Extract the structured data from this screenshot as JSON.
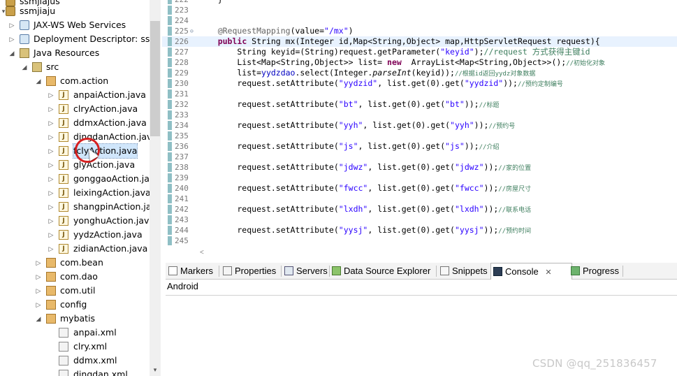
{
  "tree": {
    "rows": [
      {
        "label": "ssmjiajus",
        "icon": "project-icon"
      },
      {
        "label": "ssmjiaju",
        "icon": "project-icon"
      },
      {
        "label": "JAX-WS Web Services",
        "icon": "web-services-icon"
      },
      {
        "label": "Deployment Descriptor: ssmjiaju",
        "icon": "deployment-descriptor-icon"
      },
      {
        "label": "Java Resources",
        "icon": "java-resources-icon"
      },
      {
        "label": "src",
        "icon": "source-folder-icon"
      },
      {
        "label": "com.action",
        "icon": "package-icon"
      },
      {
        "label": "anpaiAction.java",
        "icon": "java-file-icon"
      },
      {
        "label": "clryAction.java",
        "icon": "java-file-icon"
      },
      {
        "label": "ddmxAction.java",
        "icon": "java-file-icon"
      },
      {
        "label": "dingdanAction.java",
        "icon": "java-file-icon"
      },
      {
        "label": "fclyAction.java",
        "icon": "java-file-icon"
      },
      {
        "label": "glyAction.java",
        "icon": "java-file-icon"
      },
      {
        "label": "gonggaoAction.java",
        "icon": "java-file-icon"
      },
      {
        "label": "leixingAction.java",
        "icon": "java-file-icon"
      },
      {
        "label": "shangpinAction.java",
        "icon": "java-file-icon"
      },
      {
        "label": "yonghuAction.java",
        "icon": "java-file-icon"
      },
      {
        "label": "yydzAction.java",
        "icon": "java-file-icon"
      },
      {
        "label": "zidianAction.java",
        "icon": "java-file-icon"
      },
      {
        "label": "com.bean",
        "icon": "package-icon"
      },
      {
        "label": "com.dao",
        "icon": "package-icon"
      },
      {
        "label": "com.util",
        "icon": "package-icon"
      },
      {
        "label": "config",
        "icon": "package-icon"
      },
      {
        "label": "mybatis",
        "icon": "package-icon"
      },
      {
        "label": "anpai.xml",
        "icon": "xml-file-icon"
      },
      {
        "label": "clry.xml",
        "icon": "xml-file-icon"
      },
      {
        "label": "ddmx.xml",
        "icon": "xml-file-icon"
      },
      {
        "label": "dingdan.xml",
        "icon": "xml-file-icon"
      }
    ]
  },
  "editor": {
    "lines": [
      {
        "n": "222",
        "code": "    }"
      },
      {
        "n": "223",
        "code": ""
      },
      {
        "n": "224",
        "code": ""
      },
      {
        "n": "225",
        "code": "    @RequestMapping(value=\"/mx\")"
      },
      {
        "n": "226",
        "code": "    public String mx(Integer id,Map<String,Object> map,HttpServletRequest request){"
      },
      {
        "n": "227",
        "code": "        String keyid=(String)request.getParameter(\"keyid\");//request 方式获得主键id"
      },
      {
        "n": "228",
        "code": "        List<Map<String,Object>> list= new  ArrayList<Map<String,Object>>();//初始化对象"
      },
      {
        "n": "229",
        "code": "        list=yydzdao.select(Integer.parseInt(keyid));//根据id返回yydz对象数据"
      },
      {
        "n": "230",
        "code": "        request.setAttribute(\"yydzid\", list.get(0).get(\"yydzid\"));//预约定制编号"
      },
      {
        "n": "231",
        "code": ""
      },
      {
        "n": "232",
        "code": "        request.setAttribute(\"bt\", list.get(0).get(\"bt\"));//标题"
      },
      {
        "n": "233",
        "code": ""
      },
      {
        "n": "234",
        "code": "        request.setAttribute(\"yyh\", list.get(0).get(\"yyh\"));//预约号"
      },
      {
        "n": "235",
        "code": ""
      },
      {
        "n": "236",
        "code": "        request.setAttribute(\"js\", list.get(0).get(\"js\"));//介绍"
      },
      {
        "n": "237",
        "code": ""
      },
      {
        "n": "238",
        "code": "        request.setAttribute(\"jdwz\", list.get(0).get(\"jdwz\"));//家的位置"
      },
      {
        "n": "239",
        "code": ""
      },
      {
        "n": "240",
        "code": "        request.setAttribute(\"fwcc\", list.get(0).get(\"fwcc\"));//房屋尺寸"
      },
      {
        "n": "241",
        "code": ""
      },
      {
        "n": "242",
        "code": "        request.setAttribute(\"lxdh\", list.get(0).get(\"lxdh\"));//联系电话"
      },
      {
        "n": "243",
        "code": ""
      },
      {
        "n": "244",
        "code": "        request.setAttribute(\"yysj\", list.get(0).get(\"yysj\"));//预约时间"
      },
      {
        "n": "245",
        "code": ""
      }
    ]
  },
  "views": {
    "tabs": [
      {
        "label": "Markers",
        "icon": "markers-icon"
      },
      {
        "label": "Properties",
        "icon": "properties-icon"
      },
      {
        "label": "Servers",
        "icon": "servers-icon"
      },
      {
        "label": "Data Source Explorer",
        "icon": "data-source-icon"
      },
      {
        "label": "Snippets",
        "icon": "snippets-icon"
      },
      {
        "label": "Console",
        "icon": "console-icon",
        "close": "✕"
      },
      {
        "label": "Progress",
        "icon": "progress-icon"
      }
    ],
    "console_title": "Android"
  },
  "watermark": "CSDN @qq_251836457",
  "colors": {
    "keyword": "#7f0055",
    "string": "#2a00ff",
    "comment": "#3f7f5f",
    "annotation": "#646464",
    "selection": "#d0e6fb",
    "current_line": "#e8f2fe",
    "cursor_ring": "#d62020"
  }
}
